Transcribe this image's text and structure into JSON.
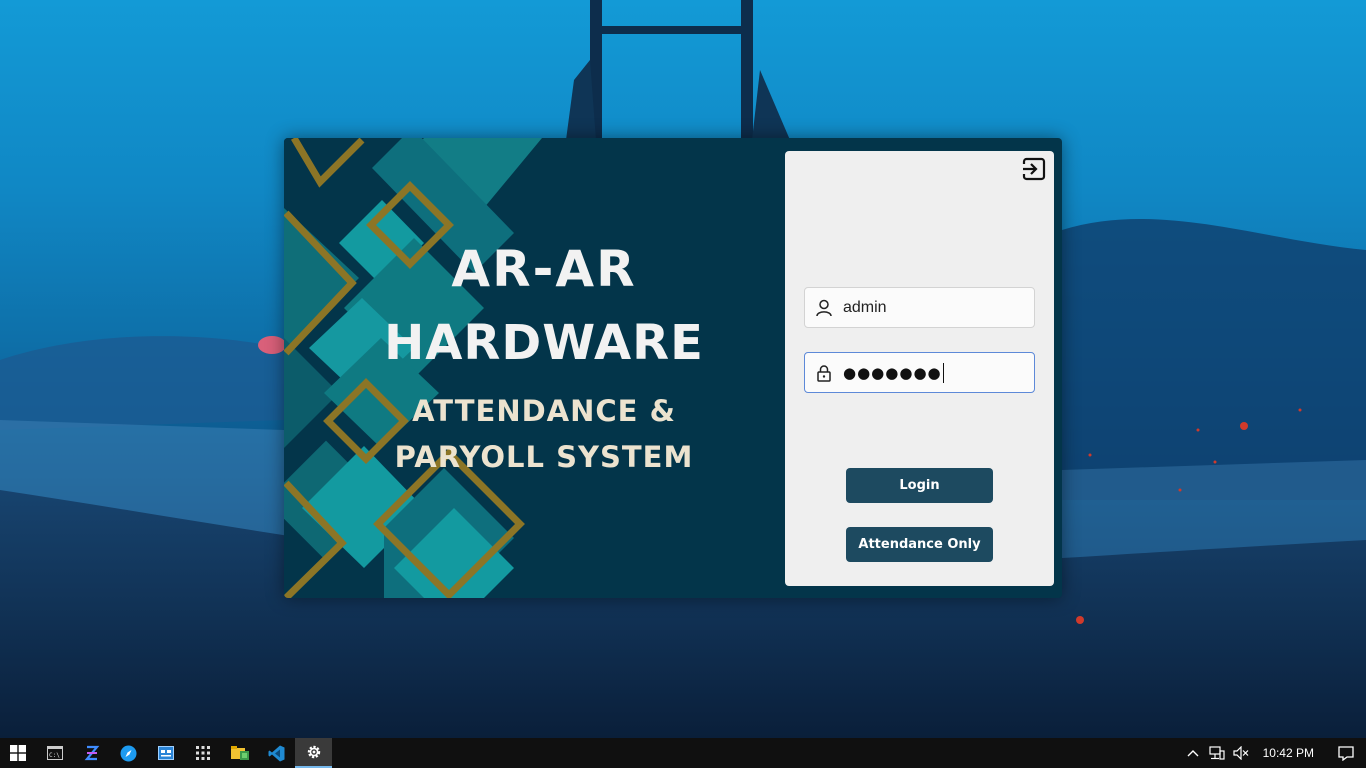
{
  "banner": {
    "brand_line1": "AR-AR",
    "brand_line2": "HARDWARE",
    "subtitle": "ATTENDANCE & PARYOLL SYSTEM"
  },
  "login_form": {
    "exit_icon": "exit-icon",
    "username": {
      "value": "admin",
      "icon": "user-icon"
    },
    "password": {
      "masked_value": "●●●●●●●",
      "icon": "lock-icon"
    },
    "login_label": "Login",
    "attendance_label": "Attendance Only"
  },
  "taskbar": {
    "apps": [
      "windows-start-icon",
      "command-prompt-icon",
      "jetbrains-ide-icon",
      "browser-icon",
      "control-panel-icon",
      "apps-grid-icon",
      "file-explorer-icon",
      "vscode-icon",
      "settings-app-icon"
    ],
    "tray": [
      "chevron-up-icon",
      "network-icon",
      "volume-muted-icon"
    ],
    "clock": "10:42 PM",
    "notification_icon": "notification-icon"
  },
  "colors": {
    "window_bg": "#03354a",
    "gold": "#8c7526",
    "teal": "#127d86",
    "button": "#1d4a60",
    "panel": "#efefef"
  }
}
